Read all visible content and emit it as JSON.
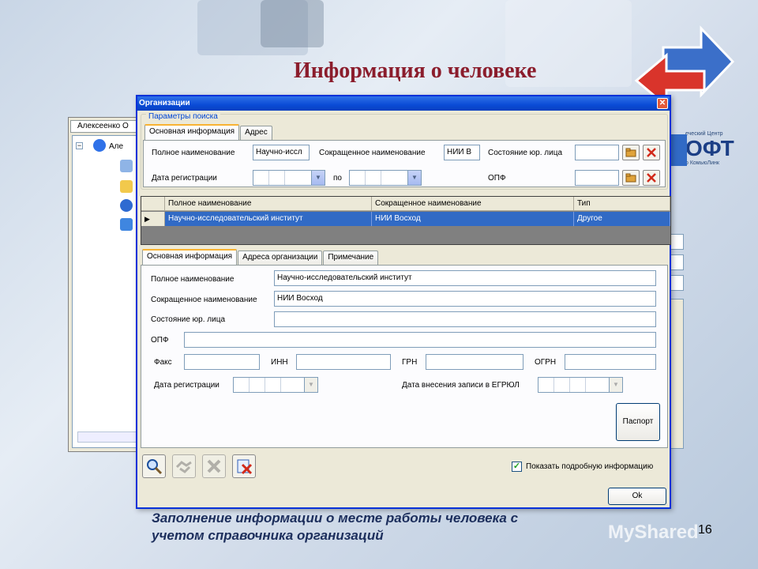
{
  "slide": {
    "title": "Информация о человеке",
    "caption_line1": "Заполнение информации о месте работы человека с",
    "caption_line2": "учетом справочника организаций",
    "page_number": "16",
    "watermark": "MyShared"
  },
  "logo": {
    "line1": "еческий Центр",
    "main": "ОФТ",
    "line2": "о КомьюЛинк"
  },
  "background_window": {
    "tab_label": "Алексеенко О",
    "tree_root_label": "Але"
  },
  "dialog": {
    "title": "Организации",
    "close_label": "✕",
    "search": {
      "legend": "Параметры поиска",
      "tabs": [
        "Основная информация",
        "Адрес"
      ],
      "full_name_label": "Полное наименование",
      "full_name_value": "Научно-иссл",
      "short_name_label": "Сокращенное наименование",
      "short_name_value": "НИИ В",
      "legal_state_label": "Состояние юр. лица",
      "legal_state_value": "",
      "reg_date_label": "Дата регистрации",
      "to_label": "по",
      "opf_label": "ОПФ",
      "opf_value": ""
    },
    "grid": {
      "columns": [
        "Полное наименование",
        "Сокращенное наименование",
        "Тип"
      ],
      "rows": [
        [
          "Научно-исследовательский институт",
          "НИИ Восход",
          "Другое"
        ]
      ],
      "selected_row_marker": "▶"
    },
    "detail": {
      "tabs": [
        "Основная информация",
        "Адреса организации",
        "Примечание"
      ],
      "full_name_label": "Полное наименование",
      "full_name_value": "Научно-исследовательский институт",
      "short_name_label": "Сокращенное наименование",
      "short_name_value": "НИИ Восход",
      "legal_state_label": "Состояние юр. лица",
      "legal_state_value": "",
      "opf_label": "ОПФ",
      "opf_value": "",
      "fax_label": "Факс",
      "inn_label": "ИНН",
      "grn_label": "ГРН",
      "ogrn_label": "ОГРН",
      "reg_date_label": "Дата регистрации",
      "egrul_date_label": "Дата внесения записи в ЕГРЮЛ",
      "passport_button": "Паспорт"
    },
    "footer": {
      "show_details_label": "Показать подробную информацию",
      "show_details_checked": true,
      "ok_button": "Ok"
    }
  },
  "colors": {
    "title": "#8b1d2c",
    "titlebar": "#0a4bd6",
    "selection": "#316ac5",
    "caption": "#1c2e5c"
  }
}
